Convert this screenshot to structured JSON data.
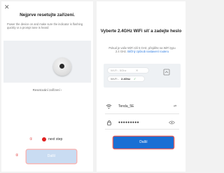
{
  "left_screen": {
    "close_glyph": "✕",
    "title": "Nejprve resetujte zařízení.",
    "instructions": "Power the device on and make sure the indicator is flashing quickly or a prompt tone is heard",
    "illustration_icon": "device-illustration",
    "reset_link": "Resetování zařízení  ›",
    "marker_1": "①",
    "next_step_label": "next step",
    "marker_2": "②",
    "button_label": "Další",
    "button_color": "#c9dcf2"
  },
  "right_screen": {
    "title": "Vyberte 2.4GHz WiFi síť a zadejte heslo",
    "instructions_plain": "Pokud je vaše WiFi sítí 5 GHz, přejděte na WiFi typu 2.4 GHz.",
    "instructions_link": "Běžný způsob nastavení routeru",
    "wifi_5g": {
      "text": "Wi-Fi - 5Ghz",
      "status": "✕"
    },
    "wifi_24g": {
      "prefix": "Wi-Fi -",
      "band": "2.4Ghz",
      "status": "✓"
    },
    "ssid": "Tenda_5E",
    "switch_icon": "⇄",
    "password": "●●●●●●●●●",
    "button_label": "Další",
    "button_color": "#1a6fd4"
  }
}
